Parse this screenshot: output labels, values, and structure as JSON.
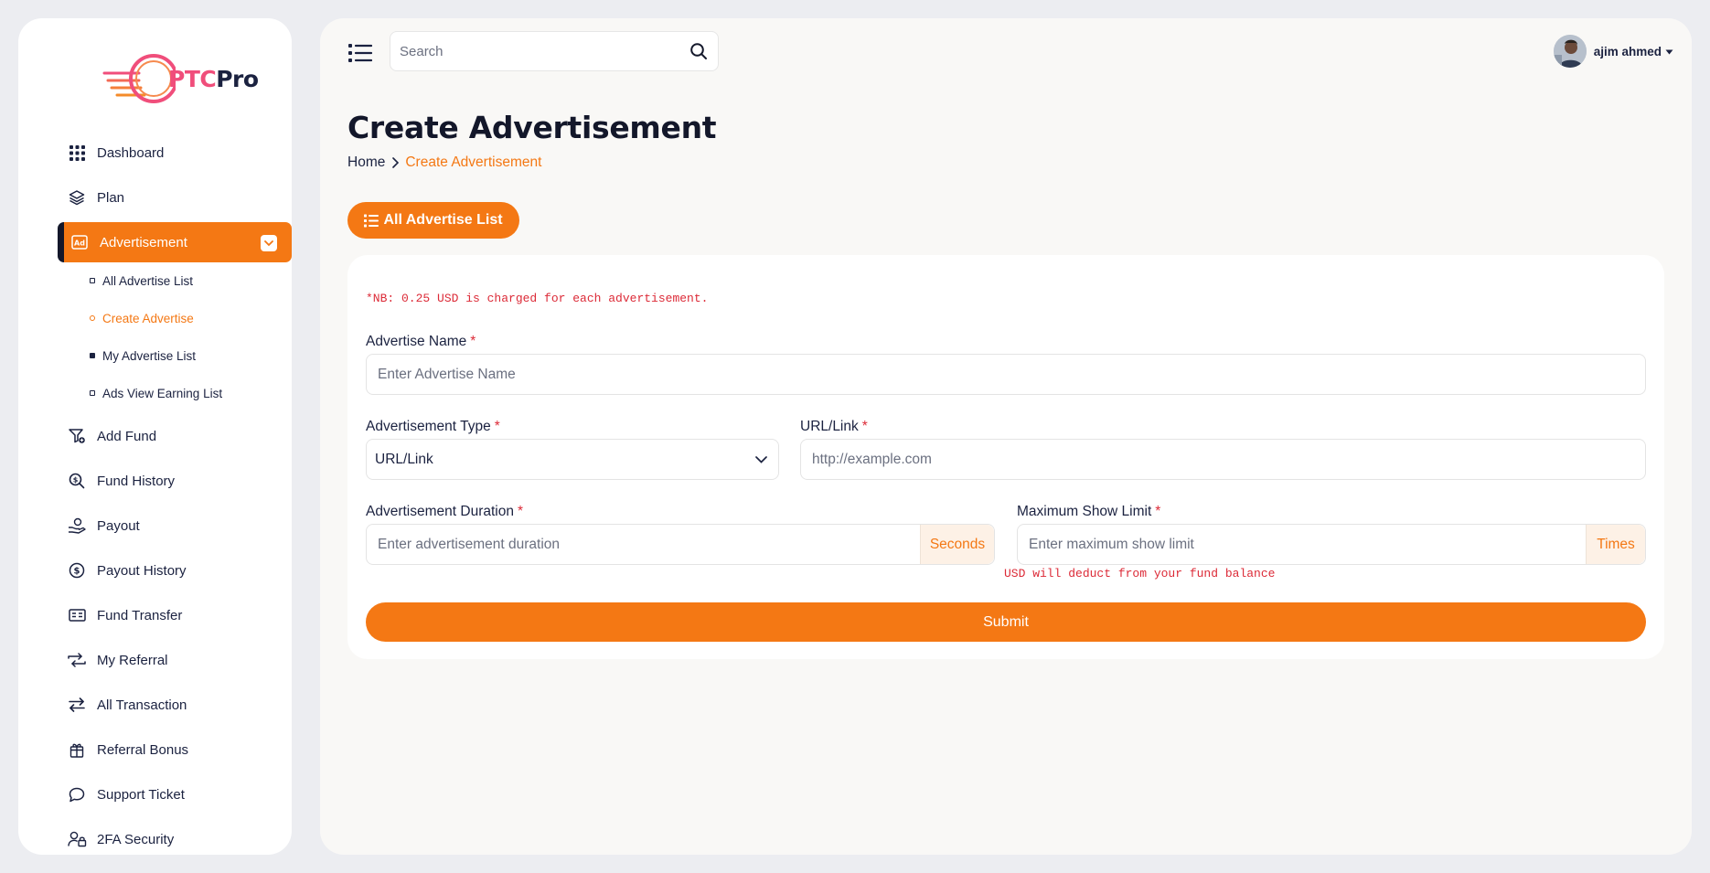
{
  "brand": {
    "name_part1": "PTC",
    "name_part2": "Pro"
  },
  "sidebar": {
    "items": [
      {
        "label": "Dashboard",
        "icon": "grid-icon"
      },
      {
        "label": "Plan",
        "icon": "layers-icon"
      },
      {
        "label": "Advertisement",
        "icon": "ad-icon",
        "active": true
      },
      {
        "label": "Add Fund",
        "icon": "funnel-add-icon"
      },
      {
        "label": "Fund History",
        "icon": "search-money-icon"
      },
      {
        "label": "Payout",
        "icon": "hand-coin-icon"
      },
      {
        "label": "Payout History",
        "icon": "dollar-circle-icon"
      },
      {
        "label": "Fund Transfer",
        "icon": "card-icon"
      },
      {
        "label": "My Referral",
        "icon": "repeat-icon"
      },
      {
        "label": "All Transaction",
        "icon": "arrows-swap-icon"
      },
      {
        "label": "Referral Bonus",
        "icon": "gift-icon"
      },
      {
        "label": "Support Ticket",
        "icon": "chat-bubble-icon"
      },
      {
        "label": "2FA Security",
        "icon": "user-lock-icon"
      }
    ],
    "subitems": [
      {
        "label": "All Advertise List"
      },
      {
        "label": "Create Advertise",
        "active": true
      },
      {
        "label": "My Advertise List"
      },
      {
        "label": "Ads View Earning List"
      }
    ]
  },
  "header": {
    "search_placeholder": "Search",
    "user_name": "ajim ahmed"
  },
  "page": {
    "title": "Create Advertisement",
    "breadcrumb_home": "Home",
    "breadcrumb_current": "Create Advertisement",
    "list_button": "All Advertise List"
  },
  "form": {
    "note": "*NB: 0.25 USD is charged for each advertisement.",
    "name_label": "Advertise Name",
    "name_placeholder": "Enter Advertise Name",
    "type_label": "Advertisement Type",
    "type_value": "URL/Link",
    "url_label": "URL/Link",
    "url_placeholder": "http://example.com",
    "duration_label": "Advertisement Duration",
    "duration_placeholder": "Enter advertisement duration",
    "duration_unit": "Seconds",
    "limit_label": "Maximum Show Limit",
    "limit_placeholder": "Enter maximum show limit",
    "limit_unit": "Times",
    "limit_help": "USD will deduct from your fund balance",
    "required_mark": "*",
    "submit_label": "Submit"
  },
  "colors": {
    "accent": "#f47814",
    "danger": "#dc2a37",
    "text": "#1b2240"
  }
}
